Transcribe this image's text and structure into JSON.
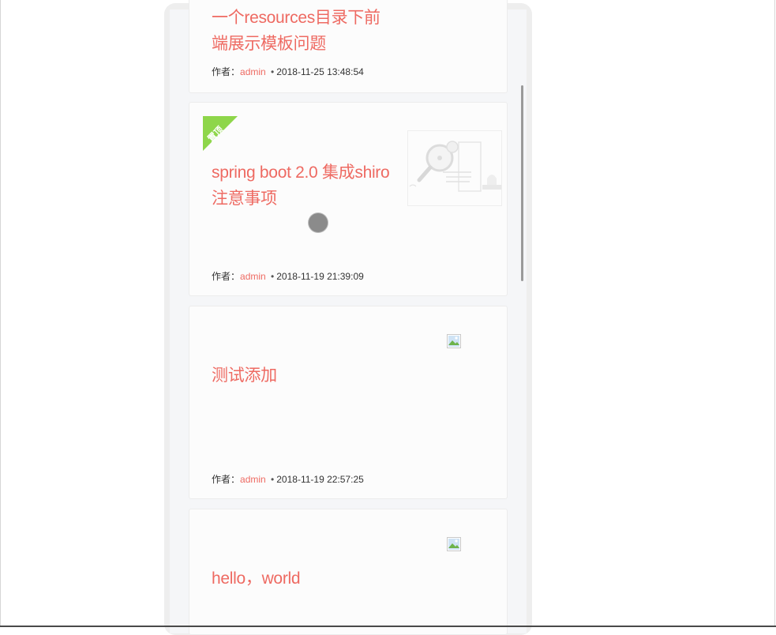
{
  "posts": [
    {
      "title_line1": "一个resources目录下前",
      "title_line2": "端展示模板问题",
      "author_label": "作者：",
      "author": "admin",
      "separator": "•",
      "date": "2018-11-25 13:48:54"
    },
    {
      "badge": "置顶",
      "title_line1": "spring boot 2.0 集成shiro",
      "title_line2": "注意事项",
      "author_label": "作者：",
      "author": "admin",
      "separator": "•",
      "date": "2018-11-19 21:39:09"
    },
    {
      "title_line1": "测试添加",
      "author_label": "作者：",
      "author": "admin",
      "separator": "•",
      "date": "2018-11-19 22:57:25"
    },
    {
      "title_line1": "hello，world"
    }
  ],
  "colors": {
    "accent": "#ee6a62",
    "badge": "#8ed64a"
  }
}
